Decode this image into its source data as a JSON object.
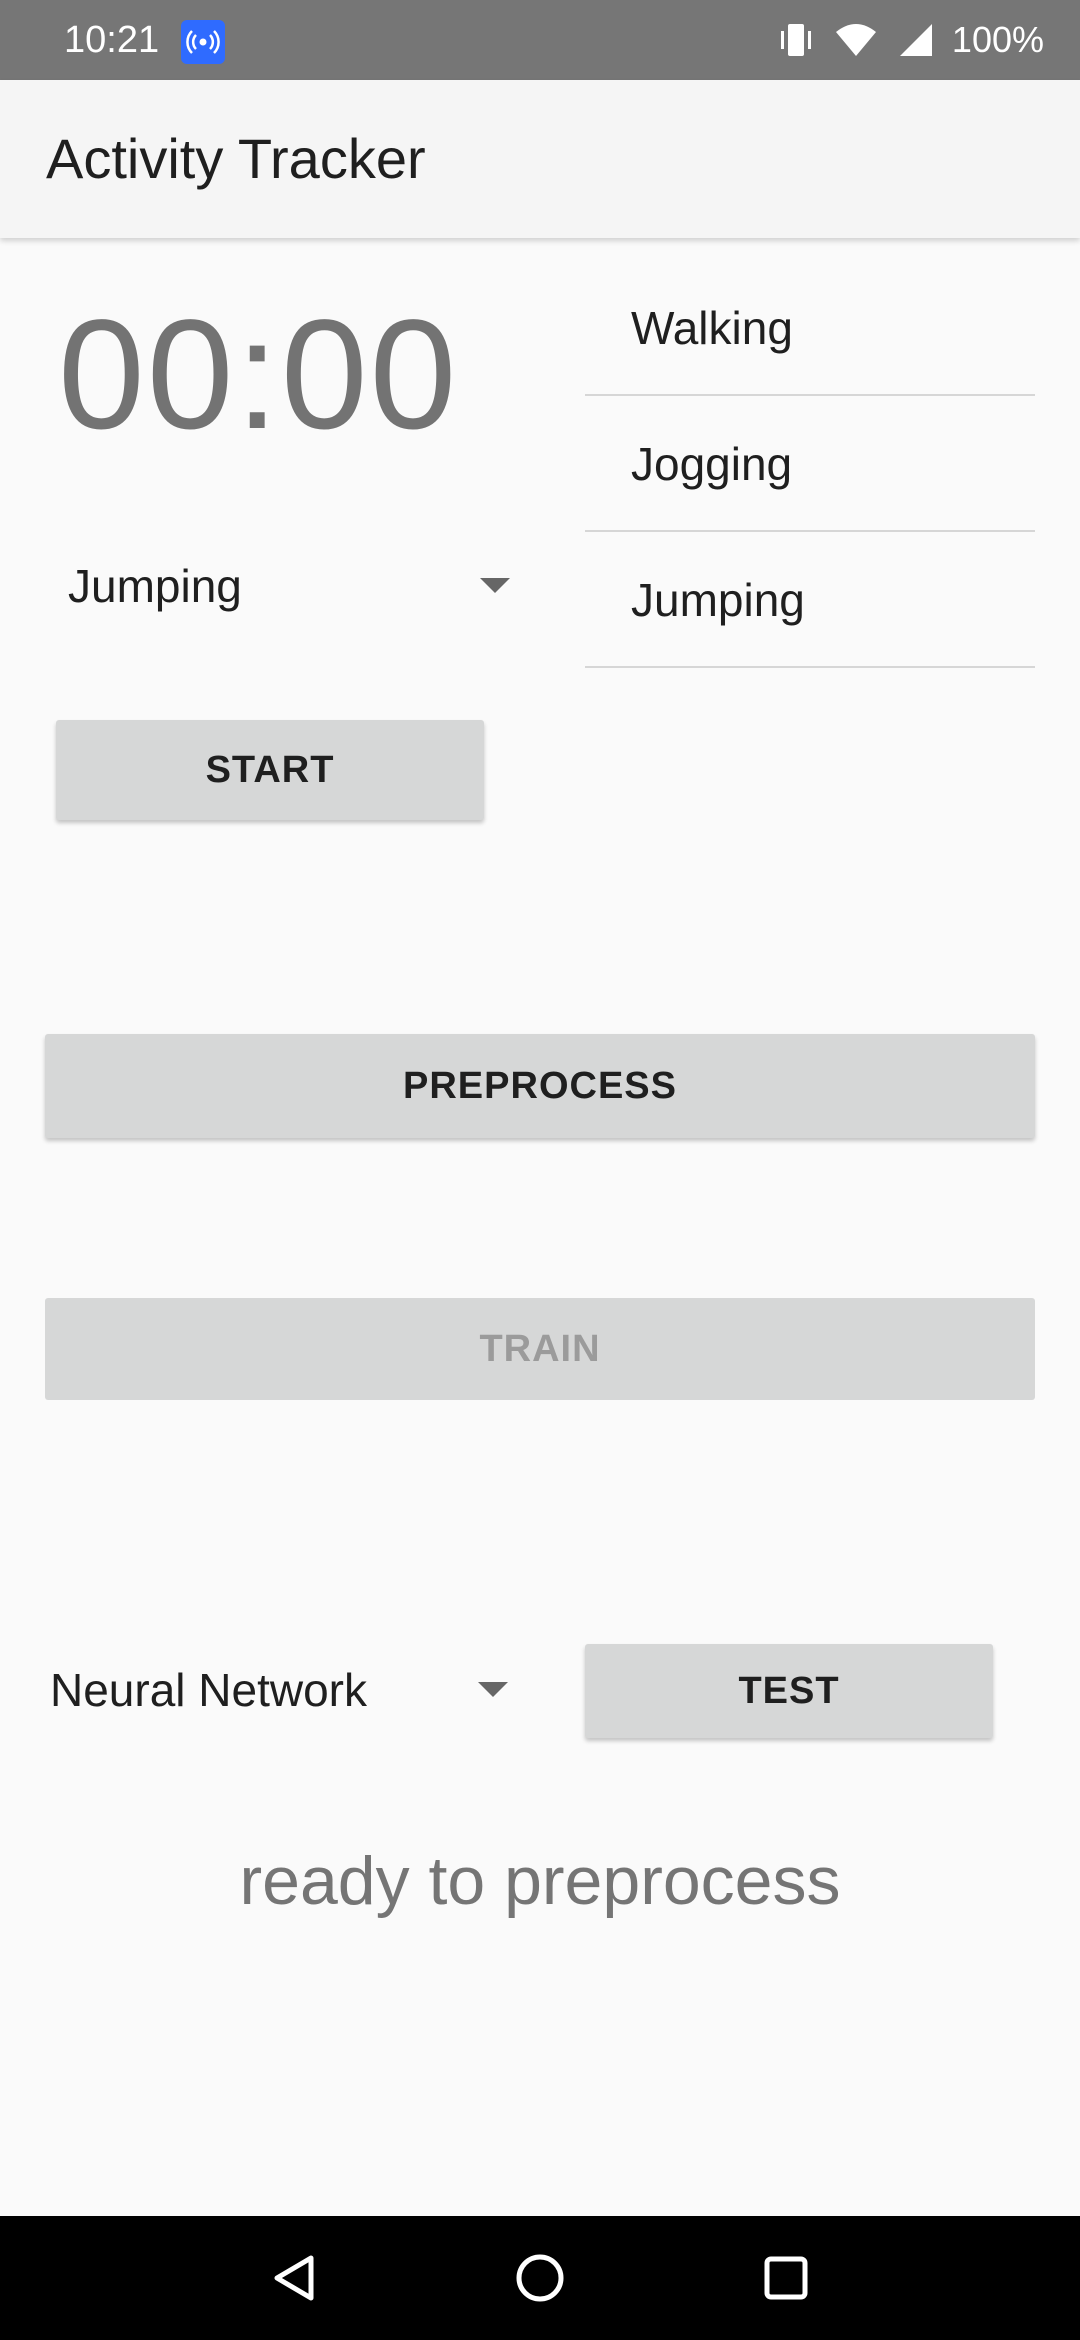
{
  "status_bar": {
    "time": "10:21",
    "battery": "100%",
    "icons": [
      "hotspot-icon",
      "vibrate-icon",
      "wifi-icon",
      "signal-icon"
    ]
  },
  "app": {
    "title": "Activity Tracker"
  },
  "timer": {
    "value": "00:00"
  },
  "activity_spinner": {
    "selected": "Jumping"
  },
  "activity_list": {
    "items": [
      "Walking",
      "Jogging",
      "Jumping"
    ]
  },
  "buttons": {
    "start": "START",
    "preprocess": "PREPROCESS",
    "train": "TRAIN",
    "test": "TEST"
  },
  "model_spinner": {
    "selected": "Neural Network"
  },
  "status_message": "ready to preprocess",
  "colors": {
    "status_bar": "#767676",
    "app_bar": "#f5f5f5",
    "background": "#fafafa",
    "button": "#d6d7d7",
    "hotspot_badge": "#2f6bff",
    "timer_text": "#737373",
    "nav_bar": "#000000"
  }
}
